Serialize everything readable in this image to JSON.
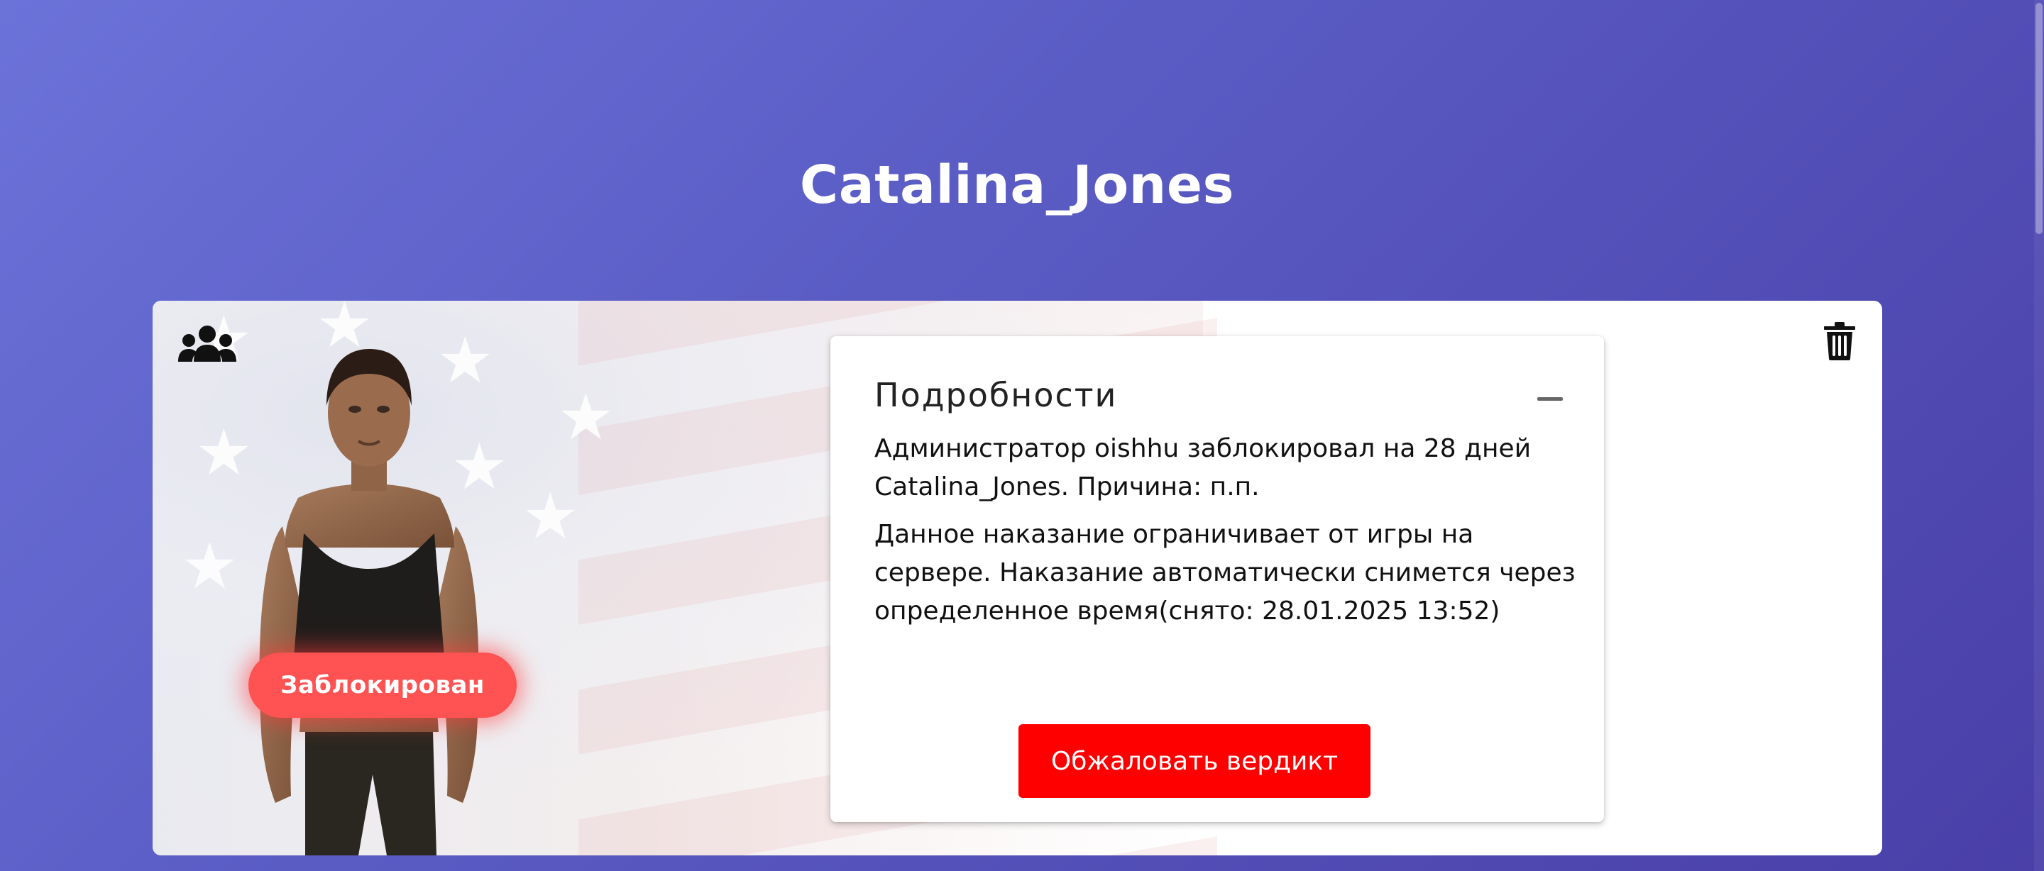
{
  "profile": {
    "nickname": "Catalina_Jones"
  },
  "card": {
    "status": "Заблокирован",
    "icons": {
      "group": "group-icon",
      "delete": "trash-icon",
      "collapse": "minus-icon"
    }
  },
  "details": {
    "title": "Подробности",
    "summary": "Администратор oishhu заблокировал на 28 дней Catalina_Jones. Причина: п.п.",
    "description": "Данное наказание ограничивает от игры на сервере. Наказание автоматически снимется через определенное время(снято: 28.01.2025 13:52)",
    "appeal_label": "Обжаловать вердикт"
  },
  "colors": {
    "background_start": "#6b72d8",
    "background_end": "#4a3fa8",
    "status_badge": "#ff5252",
    "appeal_button": "#ff0000"
  }
}
